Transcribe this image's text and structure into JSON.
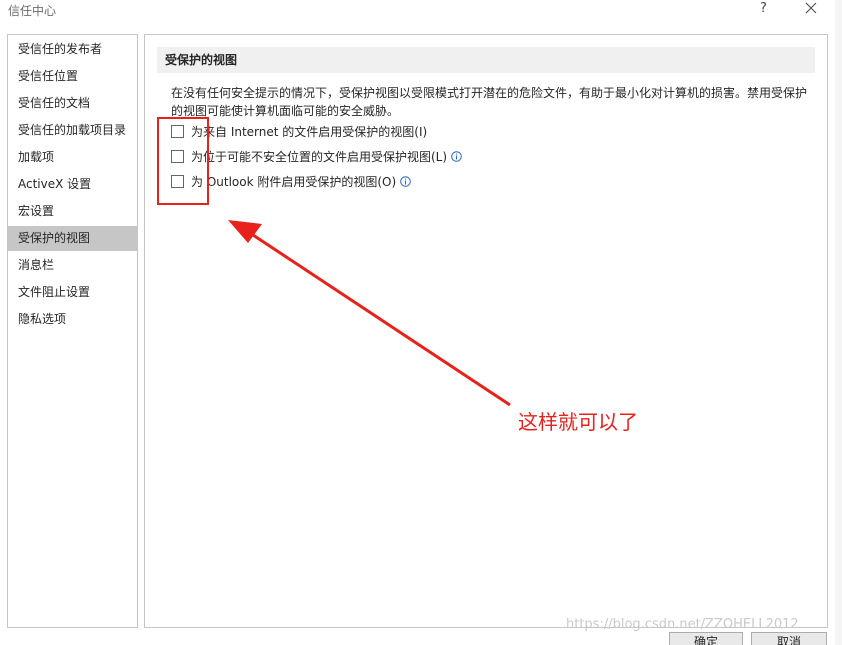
{
  "window": {
    "title": "信任中心",
    "help_label": "?"
  },
  "sidebar": {
    "items": [
      {
        "label": "受信任的发布者"
      },
      {
        "label": "受信任位置"
      },
      {
        "label": "受信任的文档"
      },
      {
        "label": "受信任的加载项目录"
      },
      {
        "label": "加载项"
      },
      {
        "label": "ActiveX 设置"
      },
      {
        "label": "宏设置"
      },
      {
        "label": "受保护的视图",
        "selected": true
      },
      {
        "label": "消息栏"
      },
      {
        "label": "文件阻止设置"
      },
      {
        "label": "隐私选项"
      }
    ]
  },
  "main": {
    "section_title": "受保护的视图",
    "description": "在没有任何安全提示的情况下，受保护视图以受限模式打开潜在的危险文件，有助于最小化对计算机的损害。禁用受保护的视图可能使计算机面临可能的安全威胁。",
    "options": [
      {
        "label": "为来自 Internet 的文件启用受保护的视图(I)",
        "checked": false,
        "info_icon": false
      },
      {
        "label": "为位于可能不安全位置的文件启用受保护视图(L)",
        "checked": false,
        "info_icon": true
      },
      {
        "label": "为 Outlook 附件启用受保护的视图(O)",
        "checked": false,
        "info_icon": true
      }
    ]
  },
  "footer": {
    "ok_label": "确定",
    "cancel_label": "取消"
  },
  "annotation": {
    "text": "这样就可以了",
    "color": "#e8211b"
  },
  "watermark": "https://blog.csdn.net/ZZOHELL2012"
}
